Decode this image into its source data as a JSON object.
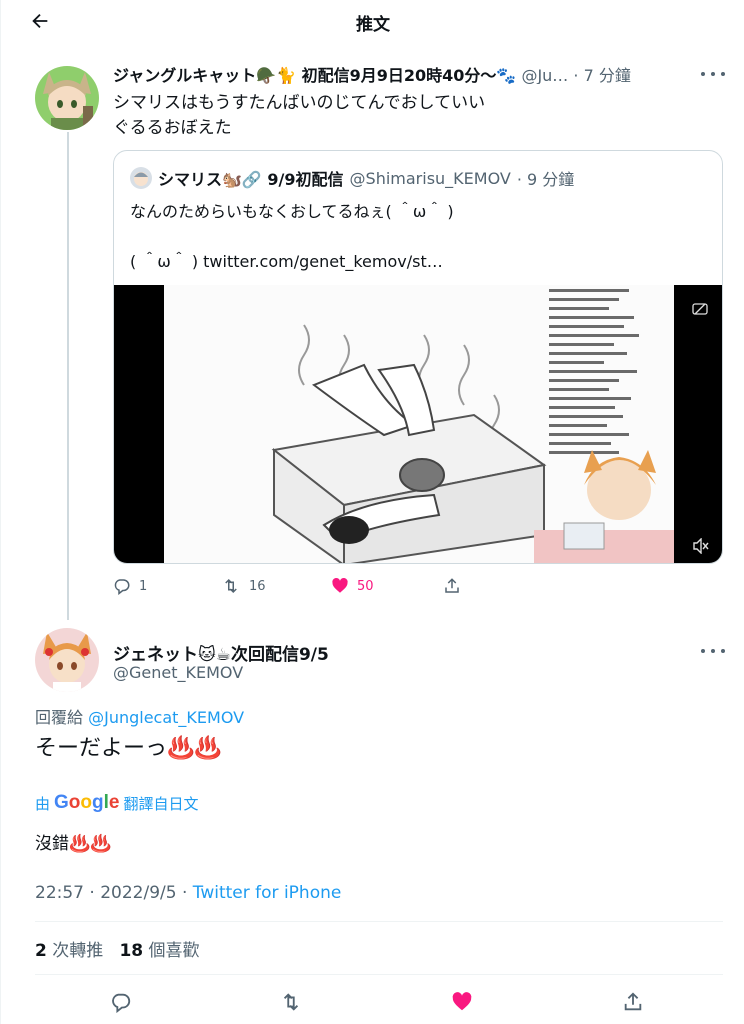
{
  "header": {
    "title": "推文"
  },
  "quoted_parent": {
    "name": "ジャングルキャット🪖🐈 初配信9月9日20時40分～🐾",
    "handle": "@Ju…",
    "time": "· 7 分鐘",
    "text": "シマリスはもうすたんばいのじてんでおしていい\nぐるるおぼえた"
  },
  "quote": {
    "name": "シマリス🐿️🔗 9/9初配信",
    "handle": "@Shimarisu_KEMOV",
    "time": "· 9 分鐘",
    "text": "なんのためらいもなくおしてるねぇ( ＾ω＾ )",
    "link_text": "( ＾ω＾ ) twitter.com/genet_kemov/st…"
  },
  "actions1": {
    "replies": "1",
    "retweets": "16",
    "likes": "50"
  },
  "main": {
    "name": "ジェネット🐱☕次回配信9/5",
    "handle": "@Genet_KEMOV",
    "reply_prefix": "回覆給",
    "reply_to": "@Junglecat_KEMOV",
    "text": "そーだよーっ♨️♨️",
    "translate_by": "由",
    "translate_brand": "Google",
    "translate_label": "翻譯自日文",
    "translation": "沒錯♨️♨️",
    "time_date": "22:57 · 2022/9/5 ·",
    "source": "Twitter for iPhone",
    "retweet_count": "2",
    "retweet_label": "次轉推",
    "like_count": "18",
    "like_label": "個喜歡"
  },
  "colors": {
    "accent": "#1d9bf0",
    "like": "#f91880",
    "muted": "#536471",
    "border": "#cfd9de"
  }
}
